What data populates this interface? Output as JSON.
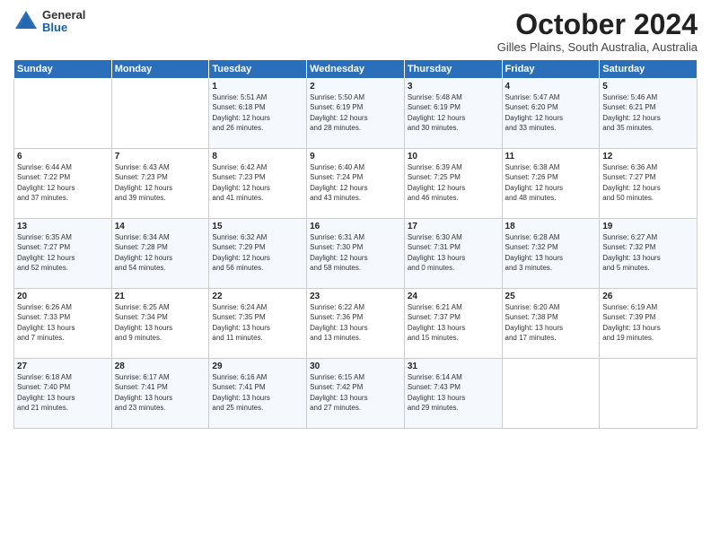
{
  "logo": {
    "general": "General",
    "blue": "Blue"
  },
  "title": "October 2024",
  "subtitle": "Gilles Plains, South Australia, Australia",
  "days_header": [
    "Sunday",
    "Monday",
    "Tuesday",
    "Wednesday",
    "Thursday",
    "Friday",
    "Saturday"
  ],
  "weeks": [
    [
      {
        "num": "",
        "detail": ""
      },
      {
        "num": "",
        "detail": ""
      },
      {
        "num": "1",
        "detail": "Sunrise: 5:51 AM\nSunset: 6:18 PM\nDaylight: 12 hours\nand 26 minutes."
      },
      {
        "num": "2",
        "detail": "Sunrise: 5:50 AM\nSunset: 6:19 PM\nDaylight: 12 hours\nand 28 minutes."
      },
      {
        "num": "3",
        "detail": "Sunrise: 5:48 AM\nSunset: 6:19 PM\nDaylight: 12 hours\nand 30 minutes."
      },
      {
        "num": "4",
        "detail": "Sunrise: 5:47 AM\nSunset: 6:20 PM\nDaylight: 12 hours\nand 33 minutes."
      },
      {
        "num": "5",
        "detail": "Sunrise: 5:46 AM\nSunset: 6:21 PM\nDaylight: 12 hours\nand 35 minutes."
      }
    ],
    [
      {
        "num": "6",
        "detail": "Sunrise: 6:44 AM\nSunset: 7:22 PM\nDaylight: 12 hours\nand 37 minutes."
      },
      {
        "num": "7",
        "detail": "Sunrise: 6:43 AM\nSunset: 7:23 PM\nDaylight: 12 hours\nand 39 minutes."
      },
      {
        "num": "8",
        "detail": "Sunrise: 6:42 AM\nSunset: 7:23 PM\nDaylight: 12 hours\nand 41 minutes."
      },
      {
        "num": "9",
        "detail": "Sunrise: 6:40 AM\nSunset: 7:24 PM\nDaylight: 12 hours\nand 43 minutes."
      },
      {
        "num": "10",
        "detail": "Sunrise: 6:39 AM\nSunset: 7:25 PM\nDaylight: 12 hours\nand 46 minutes."
      },
      {
        "num": "11",
        "detail": "Sunrise: 6:38 AM\nSunset: 7:26 PM\nDaylight: 12 hours\nand 48 minutes."
      },
      {
        "num": "12",
        "detail": "Sunrise: 6:36 AM\nSunset: 7:27 PM\nDaylight: 12 hours\nand 50 minutes."
      }
    ],
    [
      {
        "num": "13",
        "detail": "Sunrise: 6:35 AM\nSunset: 7:27 PM\nDaylight: 12 hours\nand 52 minutes."
      },
      {
        "num": "14",
        "detail": "Sunrise: 6:34 AM\nSunset: 7:28 PM\nDaylight: 12 hours\nand 54 minutes."
      },
      {
        "num": "15",
        "detail": "Sunrise: 6:32 AM\nSunset: 7:29 PM\nDaylight: 12 hours\nand 56 minutes."
      },
      {
        "num": "16",
        "detail": "Sunrise: 6:31 AM\nSunset: 7:30 PM\nDaylight: 12 hours\nand 58 minutes."
      },
      {
        "num": "17",
        "detail": "Sunrise: 6:30 AM\nSunset: 7:31 PM\nDaylight: 13 hours\nand 0 minutes."
      },
      {
        "num": "18",
        "detail": "Sunrise: 6:28 AM\nSunset: 7:32 PM\nDaylight: 13 hours\nand 3 minutes."
      },
      {
        "num": "19",
        "detail": "Sunrise: 6:27 AM\nSunset: 7:32 PM\nDaylight: 13 hours\nand 5 minutes."
      }
    ],
    [
      {
        "num": "20",
        "detail": "Sunrise: 6:26 AM\nSunset: 7:33 PM\nDaylight: 13 hours\nand 7 minutes."
      },
      {
        "num": "21",
        "detail": "Sunrise: 6:25 AM\nSunset: 7:34 PM\nDaylight: 13 hours\nand 9 minutes."
      },
      {
        "num": "22",
        "detail": "Sunrise: 6:24 AM\nSunset: 7:35 PM\nDaylight: 13 hours\nand 11 minutes."
      },
      {
        "num": "23",
        "detail": "Sunrise: 6:22 AM\nSunset: 7:36 PM\nDaylight: 13 hours\nand 13 minutes."
      },
      {
        "num": "24",
        "detail": "Sunrise: 6:21 AM\nSunset: 7:37 PM\nDaylight: 13 hours\nand 15 minutes."
      },
      {
        "num": "25",
        "detail": "Sunrise: 6:20 AM\nSunset: 7:38 PM\nDaylight: 13 hours\nand 17 minutes."
      },
      {
        "num": "26",
        "detail": "Sunrise: 6:19 AM\nSunset: 7:39 PM\nDaylight: 13 hours\nand 19 minutes."
      }
    ],
    [
      {
        "num": "27",
        "detail": "Sunrise: 6:18 AM\nSunset: 7:40 PM\nDaylight: 13 hours\nand 21 minutes."
      },
      {
        "num": "28",
        "detail": "Sunrise: 6:17 AM\nSunset: 7:41 PM\nDaylight: 13 hours\nand 23 minutes."
      },
      {
        "num": "29",
        "detail": "Sunrise: 6:16 AM\nSunset: 7:41 PM\nDaylight: 13 hours\nand 25 minutes."
      },
      {
        "num": "30",
        "detail": "Sunrise: 6:15 AM\nSunset: 7:42 PM\nDaylight: 13 hours\nand 27 minutes."
      },
      {
        "num": "31",
        "detail": "Sunrise: 6:14 AM\nSunset: 7:43 PM\nDaylight: 13 hours\nand 29 minutes."
      },
      {
        "num": "",
        "detail": ""
      },
      {
        "num": "",
        "detail": ""
      }
    ]
  ]
}
